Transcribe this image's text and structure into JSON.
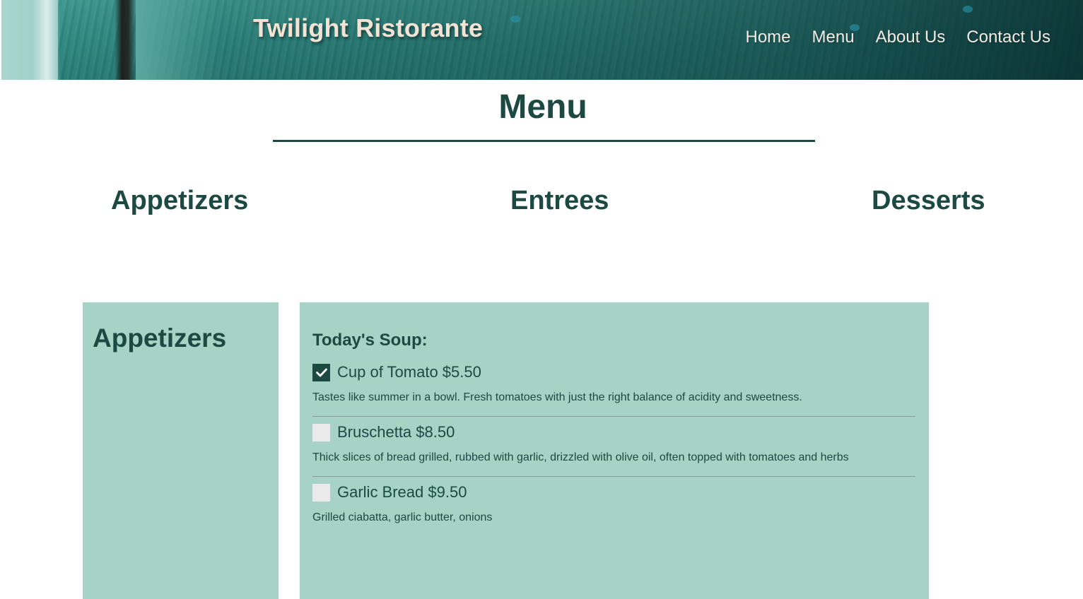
{
  "header": {
    "brand": "Twilight Ristorante",
    "nav": [
      "Home",
      "Menu",
      "About Us",
      "Contact Us"
    ]
  },
  "page": {
    "title": "Menu"
  },
  "categories": [
    "Appetizers",
    "Entrees",
    "Desserts"
  ],
  "side_panel": {
    "heading": "Appetizers"
  },
  "main_panel": {
    "section_label": "Today's Soup:",
    "items": [
      {
        "name": "Cup of Tomato $5.50",
        "checked": true,
        "description": "Tastes like summer in a bowl. Fresh tomatoes with just the right balance of acidity and sweetness."
      },
      {
        "name": "Bruschetta $8.50",
        "checked": false,
        "description": "Thick slices of bread grilled, rubbed with garlic, drizzled with olive oil, often topped with tomatoes and herbs"
      },
      {
        "name": "Garlic Bread $9.50",
        "checked": false,
        "description": "Grilled ciabatta, garlic butter, onions"
      }
    ]
  },
  "icons": {
    "checkmark": "check-icon"
  },
  "colors": {
    "primary_text": "#1c4a42",
    "panel_bg": "#a6d3c6",
    "header_text": "#f3e3d4",
    "checkbox_unchecked": "#e9eae9"
  }
}
